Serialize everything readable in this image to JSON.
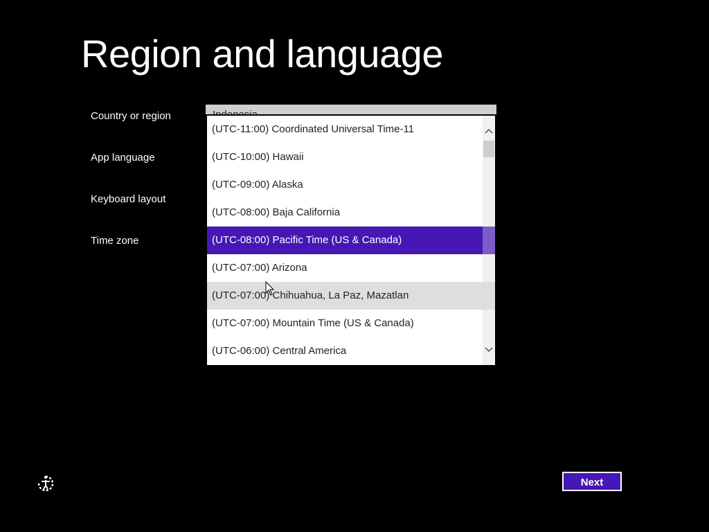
{
  "page": {
    "title": "Region and language"
  },
  "form": {
    "labels": {
      "country": "Country or region",
      "app_language": "App language",
      "keyboard": "Keyboard layout",
      "time_zone": "Time zone"
    },
    "country_value": "Indonesia"
  },
  "time_zone_dropdown": {
    "options": [
      "(UTC-11:00) Coordinated Universal Time-11",
      "(UTC-10:00) Hawaii",
      "(UTC-09:00) Alaska",
      "(UTC-08:00) Baja California",
      "(UTC-08:00) Pacific Time (US & Canada)",
      "(UTC-07:00) Arizona",
      "(UTC-07:00) Chihuahua, La Paz, Mazatlan",
      "(UTC-07:00) Mountain Time (US & Canada)",
      "(UTC-06:00) Central America"
    ],
    "selected": "(UTC-08:00) Pacific Time (US & Canada)",
    "hovered": "(UTC-07:00) Chihuahua, La Paz, Mazatlan"
  },
  "buttons": {
    "next": "Next"
  },
  "icons": {
    "ease_of_access": "ease-of-access-icon",
    "scroll_up": "chevron-up-icon",
    "scroll_down": "chevron-down-icon",
    "cursor": "mouse-pointer-icon"
  },
  "colors": {
    "background": "#000000",
    "accent": "#4617b4",
    "hover": "#dedede",
    "text_light": "#ffffff",
    "text_dark": "#222222"
  }
}
